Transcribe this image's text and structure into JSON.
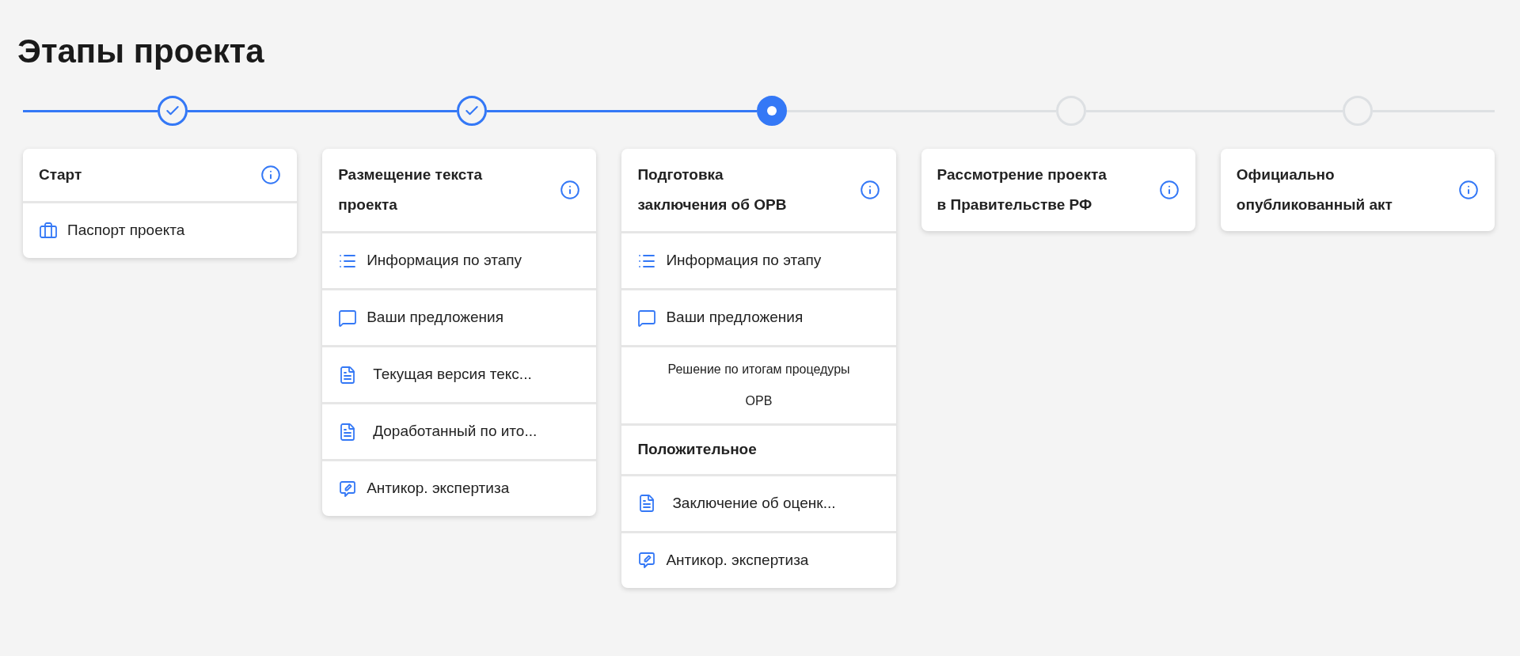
{
  "title": "Этапы проекта",
  "stages": [
    {
      "done": true,
      "current": false,
      "title": "Старт",
      "items": [
        {
          "kind": "briefcase",
          "text": "Паспорт проекта"
        }
      ]
    },
    {
      "done": true,
      "current": false,
      "title": "Размещение текста проекта",
      "items": [
        {
          "kind": "list",
          "text": "Информация по этапу"
        },
        {
          "kind": "comment",
          "text": "Ваши предложения"
        },
        {
          "kind": "document",
          "text": "Текущая версия текс..."
        },
        {
          "kind": "document",
          "text": "Доработанный по ито..."
        },
        {
          "kind": "edit",
          "text": "Антикор. экспертиза"
        }
      ]
    },
    {
      "done": false,
      "current": true,
      "title": "Подготовка заключения об ОРВ",
      "items": [
        {
          "kind": "list",
          "text": "Информация по этапу"
        },
        {
          "kind": "comment",
          "text": "Ваши предложения"
        },
        {
          "kind": "note",
          "text": "Решение по итогам процедуры ОРВ"
        },
        {
          "kind": "status",
          "text": "Положительное"
        },
        {
          "kind": "document",
          "text": "Заключение об оценк..."
        },
        {
          "kind": "edit",
          "text": "Антикор. экспертиза"
        }
      ]
    },
    {
      "done": false,
      "current": false,
      "title": "Рассмотрение проекта в Правительстве РФ"
    },
    {
      "done": false,
      "current": false,
      "title": "Официально опубликованный акт"
    }
  ]
}
